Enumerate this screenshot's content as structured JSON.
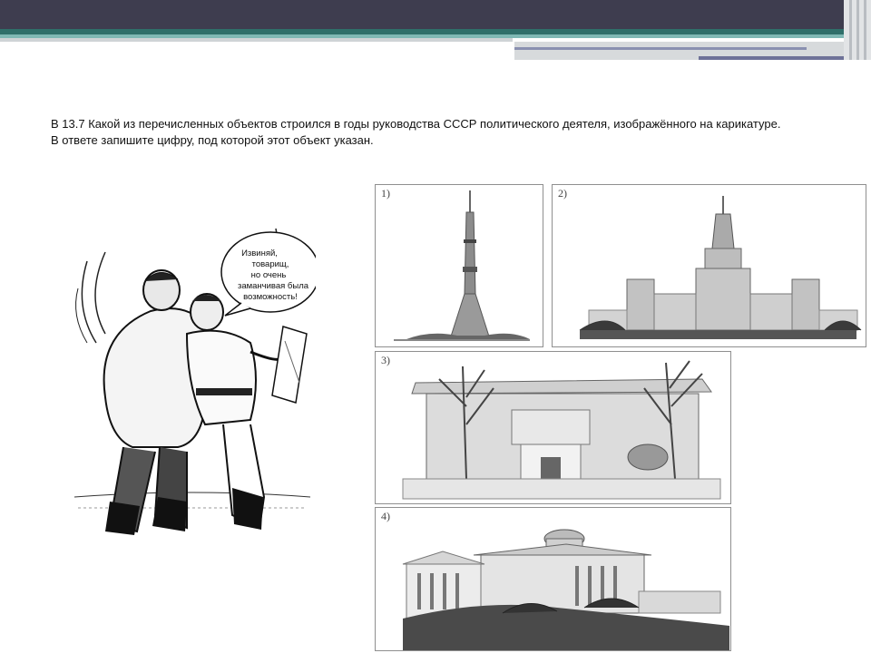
{
  "question": {
    "line1": "В 13.7 Какой из перечисленных объектов строился в годы руководства СССР политического деятеля, изображённого на карикатуре.",
    "line2": "В ответе запишите цифру, под которой этот объект указан."
  },
  "cartoon": {
    "speech": [
      "Извиняй,",
      "товарищ,",
      "но очень",
      "заманчивая была",
      "возможность!"
    ]
  },
  "options": [
    {
      "label": "1)"
    },
    {
      "label": "2)"
    },
    {
      "label": "3)"
    },
    {
      "label": "4)"
    }
  ]
}
